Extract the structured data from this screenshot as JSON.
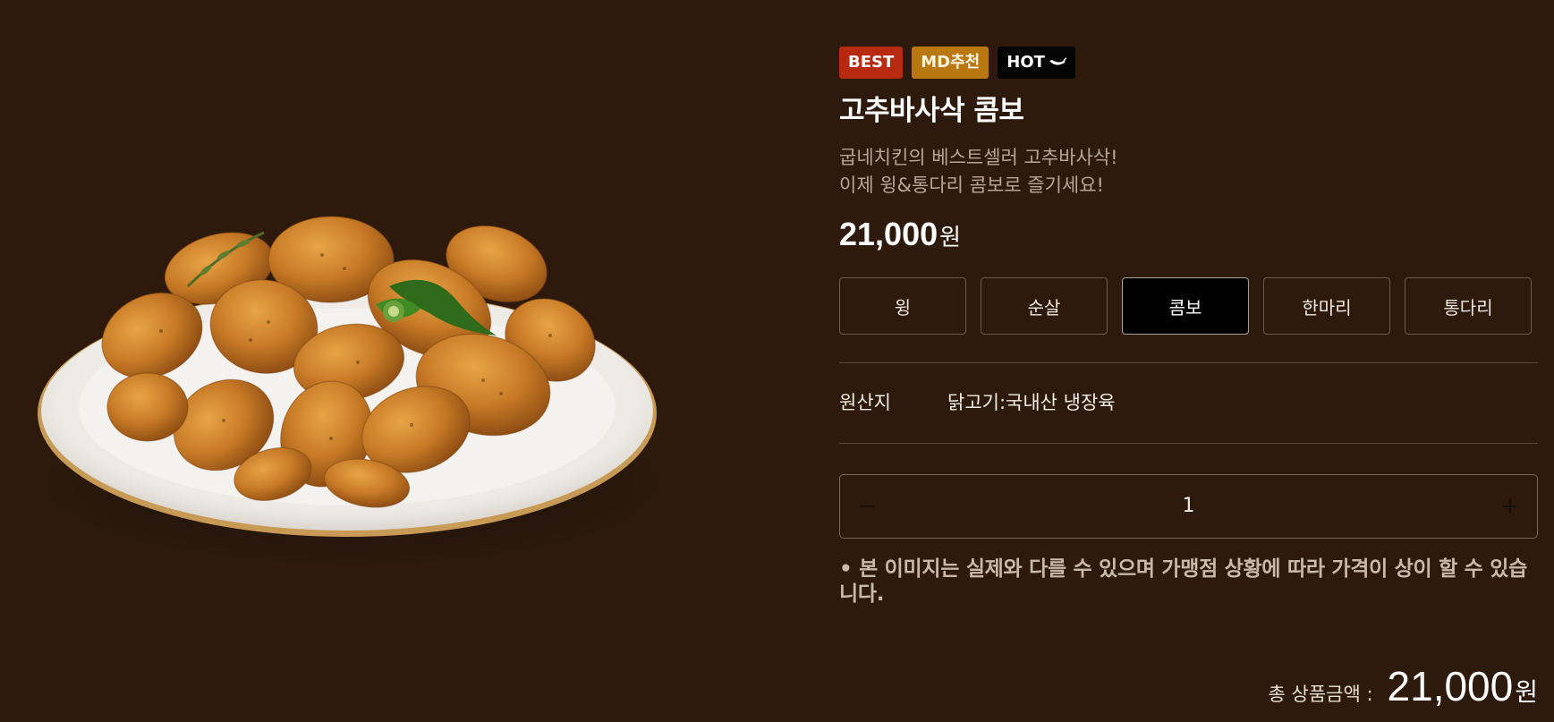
{
  "product": {
    "badges": [
      {
        "label": "BEST",
        "color": "#b82a10"
      },
      {
        "label": "MD추천",
        "color": "#b8770f"
      },
      {
        "label": "HOT",
        "color": "#050505",
        "icon": "chili-pepper-icon"
      }
    ],
    "title": "고추바사삭 콤보",
    "description_lines": [
      "굽네치킨의 베스트셀러 고추바사삭!",
      "이제 윙&통다리 콤보로 즐기세요!"
    ],
    "price": "21,000",
    "price_unit": "원",
    "image_icon": "fried-chicken-plate-image"
  },
  "options": {
    "items": [
      "윙",
      "순살",
      "콤보",
      "한마리",
      "통다리"
    ],
    "selected": "콤보"
  },
  "origin": {
    "label": "원산지",
    "value": "닭고기:국내산 냉장육"
  },
  "quantity": {
    "value": "1",
    "minus_icon": "minus-icon",
    "plus_icon": "plus-icon"
  },
  "notice": "• 본 이미지는 실제와 다를 수 있으며 가맹점 상황에 따라 가격이 상이 할 수 있습니다.",
  "total": {
    "label": "총 상품금액 :",
    "amount": "21,000",
    "unit": "원"
  },
  "colors": {
    "background": "#2d1a0d",
    "selected_option": "#000000"
  }
}
